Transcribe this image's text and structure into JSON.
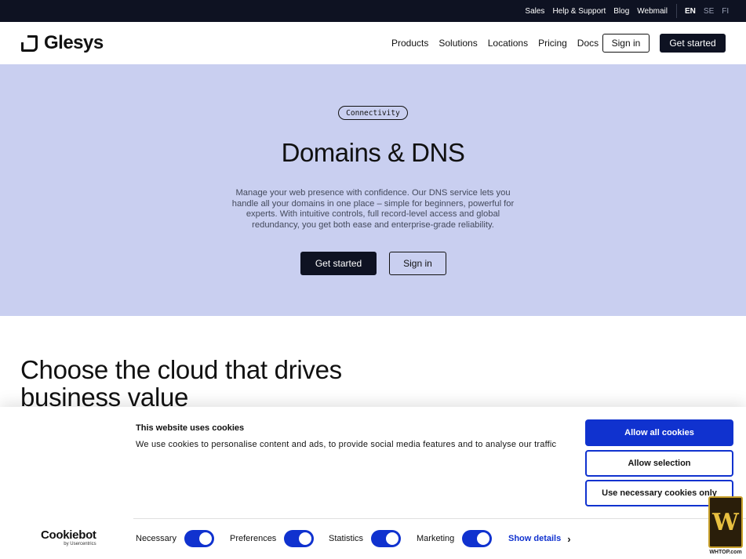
{
  "topbar": {
    "links": [
      "Sales",
      "Help & Support",
      "Blog",
      "Webmail"
    ],
    "languages": [
      "EN",
      "SE",
      "FI"
    ],
    "active_language": "EN"
  },
  "nav": {
    "logo_text": "Glesys",
    "items": [
      "Products",
      "Solutions",
      "Locations",
      "Pricing",
      "Docs"
    ],
    "sign_in": "Sign in",
    "get_started": "Get started"
  },
  "hero": {
    "tag": "Connectivity",
    "title": "Domains & DNS",
    "description": "Manage your web presence with confidence. Our DNS service lets you handle all your domains in one place – simple for beginners, powerful for experts. With intuitive controls, full record-level access and global redundancy, you get both ease and enterprise-grade reliability.",
    "primary_button": "Get started",
    "secondary_button": "Sign in"
  },
  "section": {
    "title": "Choose the cloud that drives business value"
  },
  "cookie_banner": {
    "title": "This website uses cookies",
    "description": "We use cookies to personalise content and ads, to provide social media features and to analyse our traffic",
    "allow_all": "Allow all cookies",
    "allow_selection": "Allow selection",
    "necessary_only": "Use necessary cookies only",
    "brand": "Cookiebot",
    "brand_sub": "by Usercentrics",
    "toggles": [
      {
        "label": "Necessary",
        "on": true
      },
      {
        "label": "Preferences",
        "on": true
      },
      {
        "label": "Statistics",
        "on": true
      },
      {
        "label": "Marketing",
        "on": true
      }
    ],
    "show_details": "Show details",
    "accent_color": "#1032cf"
  },
  "watermark": {
    "mark": "W",
    "text": "WHTOP.com"
  }
}
